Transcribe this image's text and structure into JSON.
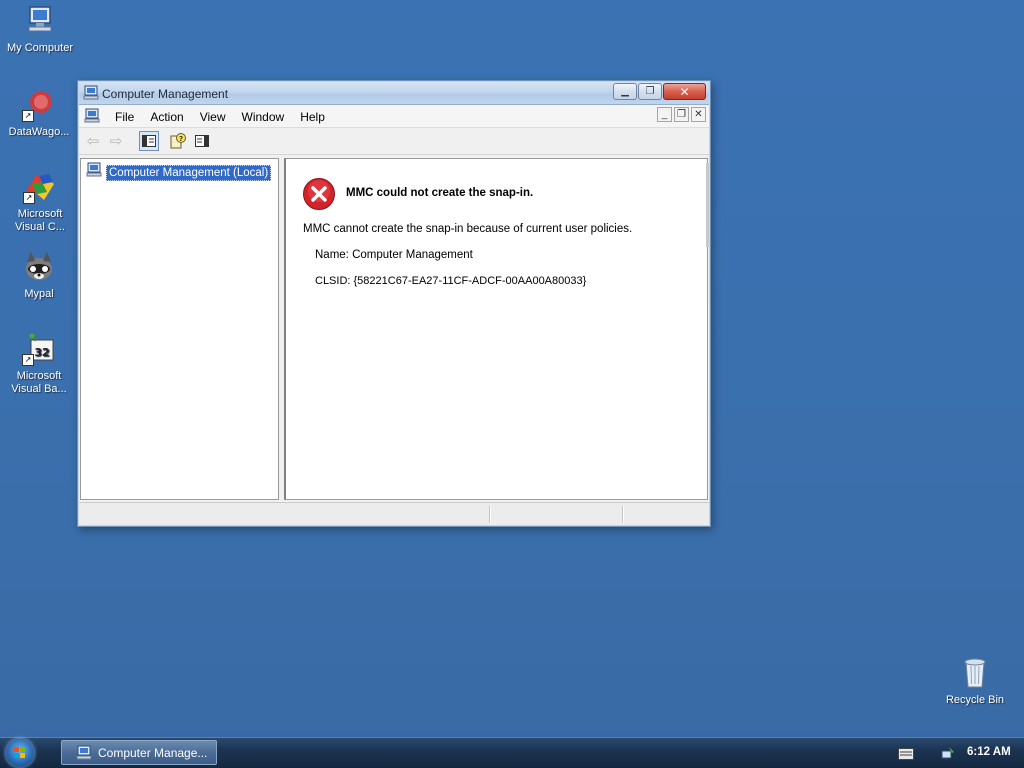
{
  "desktop": {
    "icons": [
      {
        "label": "My Computer",
        "icon": "computer-icon"
      },
      {
        "label": "DataWago...",
        "icon": "datawagon-icon"
      },
      {
        "label": "Microsoft Visual C...",
        "icon": "visual-c-icon"
      },
      {
        "label": "Mypal",
        "icon": "mypal-icon"
      },
      {
        "label": "Microsoft Visual Ba...",
        "icon": "visual-basic-icon"
      },
      {
        "label": "Recycle Bin",
        "icon": "recycle-bin-icon"
      }
    ]
  },
  "window": {
    "title": "Computer Management",
    "menu": [
      "File",
      "Action",
      "View",
      "Window",
      "Help"
    ],
    "tree": {
      "root_label": "Computer Management (Local)"
    },
    "error": {
      "title": "MMC could not create the snap-in.",
      "message": "MMC cannot create the snap-in because of current user policies.",
      "name_line": "Name: Computer Management",
      "clsid_line": "CLSID: {58221C67-EA27-11CF-ADCF-00AA00A80033}"
    }
  },
  "taskbar": {
    "task_label": "Computer Manage...",
    "clock": "6:12 AM"
  },
  "colors": {
    "desktop": "#3a6fac",
    "selection": "#3169c6",
    "error_red": "#d1232a"
  }
}
